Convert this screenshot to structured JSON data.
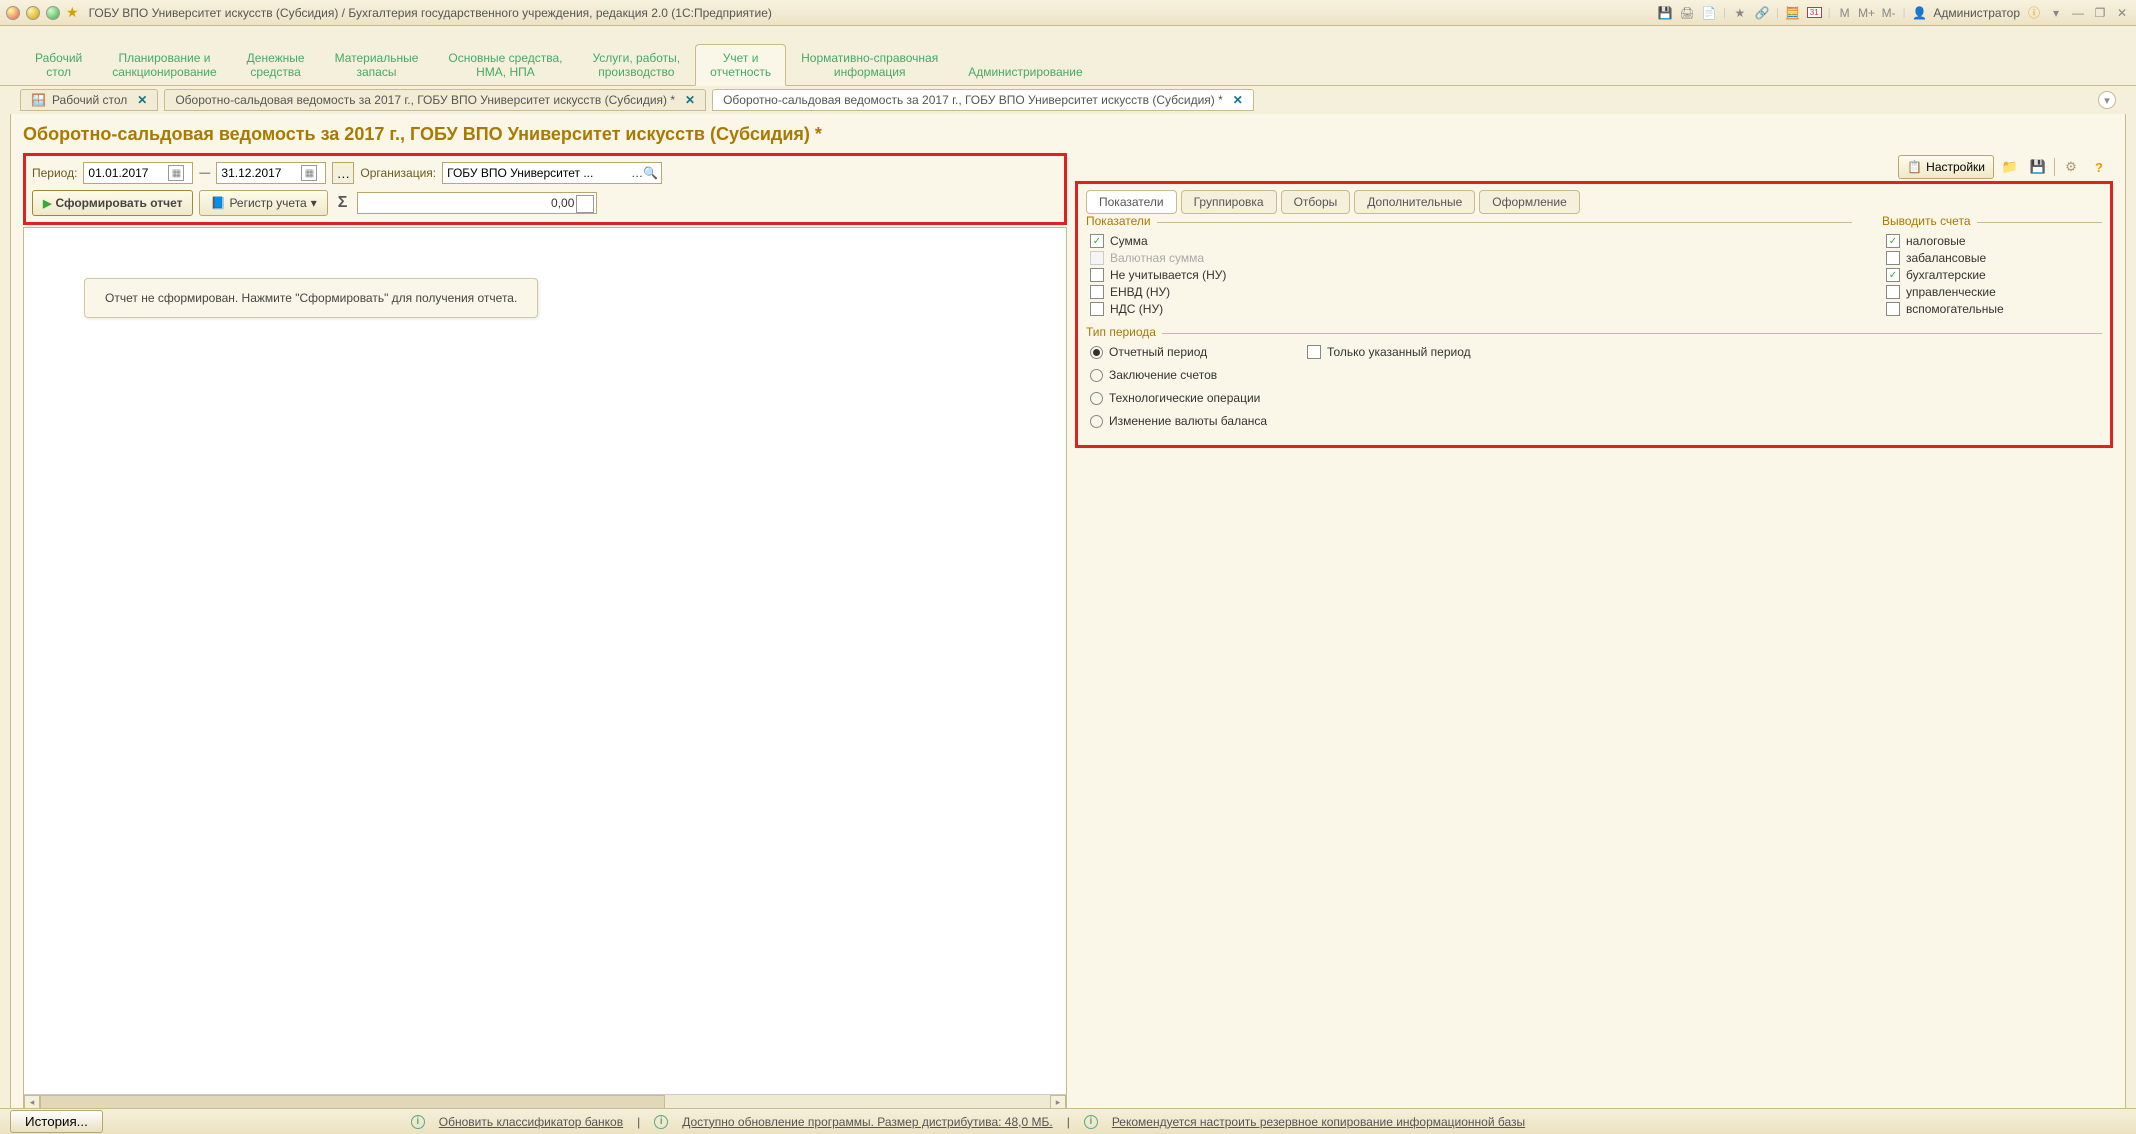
{
  "titlebar": {
    "title": "ГОБУ ВПО Университет искусств (Субсидия) / Бухгалтерия государственного учреждения, редакция 2.0  (1С:Предприятие)",
    "user": "Администратор",
    "m": "M",
    "mplus": "M+",
    "mminus": "M-"
  },
  "sections": [
    "Рабочий\nстол",
    "Планирование и\nсанкционирование",
    "Денежные\nсредства",
    "Материальные\nзапасы",
    "Основные средства,\nНМА, НПА",
    "Услуги, работы,\nпроизводство",
    "Учет и\nотчетность",
    "Нормативно-справочная\nинформация",
    "Администрирование"
  ],
  "section_active_index": 6,
  "wintabs": [
    {
      "label": "Рабочий стол"
    },
    {
      "label": "Оборотно-сальдовая ведомость за 2017 г., ГОБУ ВПО Университет искусств (Субсидия) *"
    },
    {
      "label": "Оборотно-сальдовая ведомость за 2017 г., ГОБУ ВПО Университет искусств (Субсидия) *"
    }
  ],
  "wintab_active_index": 2,
  "page_title": "Оборотно-сальдовая ведомость за 2017 г., ГОБУ ВПО Университет искусств (Субсидия) *",
  "params": {
    "period_label": "Период:",
    "date_from": "01.01.2017",
    "date_to": "31.12.2017",
    "org_label": "Организация:",
    "org_value": "ГОБУ ВПО Университет ...",
    "form_btn": "Сформировать отчет",
    "register_btn": "Регистр учета",
    "sum_value": "0,00"
  },
  "report_msg": "Отчет не сформирован. Нажмите \"Сформировать\" для получения отчета.",
  "settings": {
    "btn_label": "Настройки",
    "tabs": [
      "Показатели",
      "Группировка",
      "Отборы",
      "Дополнительные",
      "Оформление"
    ],
    "active_tab": 0,
    "indicators_title": "Показатели",
    "indicators": [
      {
        "label": "Сумма",
        "checked": true,
        "disabled": false
      },
      {
        "label": "Валютная сумма",
        "checked": false,
        "disabled": true
      },
      {
        "label": "Не учитывается (НУ)",
        "checked": false,
        "disabled": false
      },
      {
        "label": "ЕНВД (НУ)",
        "checked": false,
        "disabled": false
      },
      {
        "label": "НДС (НУ)",
        "checked": false,
        "disabled": false
      }
    ],
    "accounts_title": "Выводить счета",
    "accounts": [
      {
        "label": "налоговые",
        "checked": true
      },
      {
        "label": "забалансовые",
        "checked": false
      },
      {
        "label": "бухгалтерские",
        "checked": true
      },
      {
        "label": "управленческие",
        "checked": false
      },
      {
        "label": "вспомогательные",
        "checked": false
      }
    ],
    "period_type_title": "Тип периода",
    "period_col1": [
      {
        "label": "Отчетный период",
        "checked": true
      },
      {
        "label": "Заключение счетов",
        "checked": false
      },
      {
        "label": "Технологические операции",
        "checked": false
      },
      {
        "label": "Изменение валюты баланса",
        "checked": false
      }
    ],
    "period_col2": [
      {
        "label": "Только указанный период",
        "checked": false,
        "type": "checkbox"
      }
    ]
  },
  "statusbar": {
    "history": "История...",
    "link1": "Обновить классификатор банков",
    "link2": "Доступно обновление программы. Размер дистрибутива: 48,0 МБ.",
    "link3": "Рекомендуется настроить резервное копирование информационной базы"
  }
}
